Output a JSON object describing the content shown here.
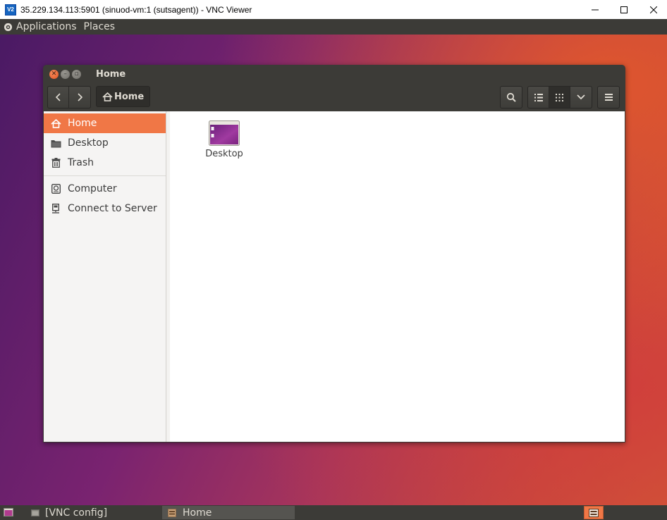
{
  "vnc_window": {
    "logo_text": "V2",
    "title": "35.229.134.113:5901 (sinuod-vm:1 (sutsagent)) - VNC Viewer"
  },
  "top_panel": {
    "applications_label": "Applications",
    "places_label": "Places"
  },
  "file_window": {
    "title": "Home",
    "path_button_label": "Home"
  },
  "sidebar": {
    "places": [
      {
        "label": "Home",
        "icon": "home-icon",
        "active": true
      },
      {
        "label": "Desktop",
        "icon": "folder-icon",
        "active": false
      },
      {
        "label": "Trash",
        "icon": "trash-icon",
        "active": false
      }
    ],
    "devices": [
      {
        "label": "Computer",
        "icon": "computer-icon"
      },
      {
        "label": "Connect to Server",
        "icon": "server-icon"
      }
    ]
  },
  "files": [
    {
      "name": "Desktop",
      "icon": "desktop-folder-icon"
    }
  ],
  "taskbar": {
    "tasks": [
      {
        "label": "[VNC config]",
        "icon": "window-icon"
      },
      {
        "label": "Home",
        "icon": "file-manager-icon",
        "active": true
      }
    ]
  },
  "colors": {
    "accent": "#f07746",
    "panel": "#3c3b37",
    "sidebar_bg": "#f5f4f3"
  }
}
